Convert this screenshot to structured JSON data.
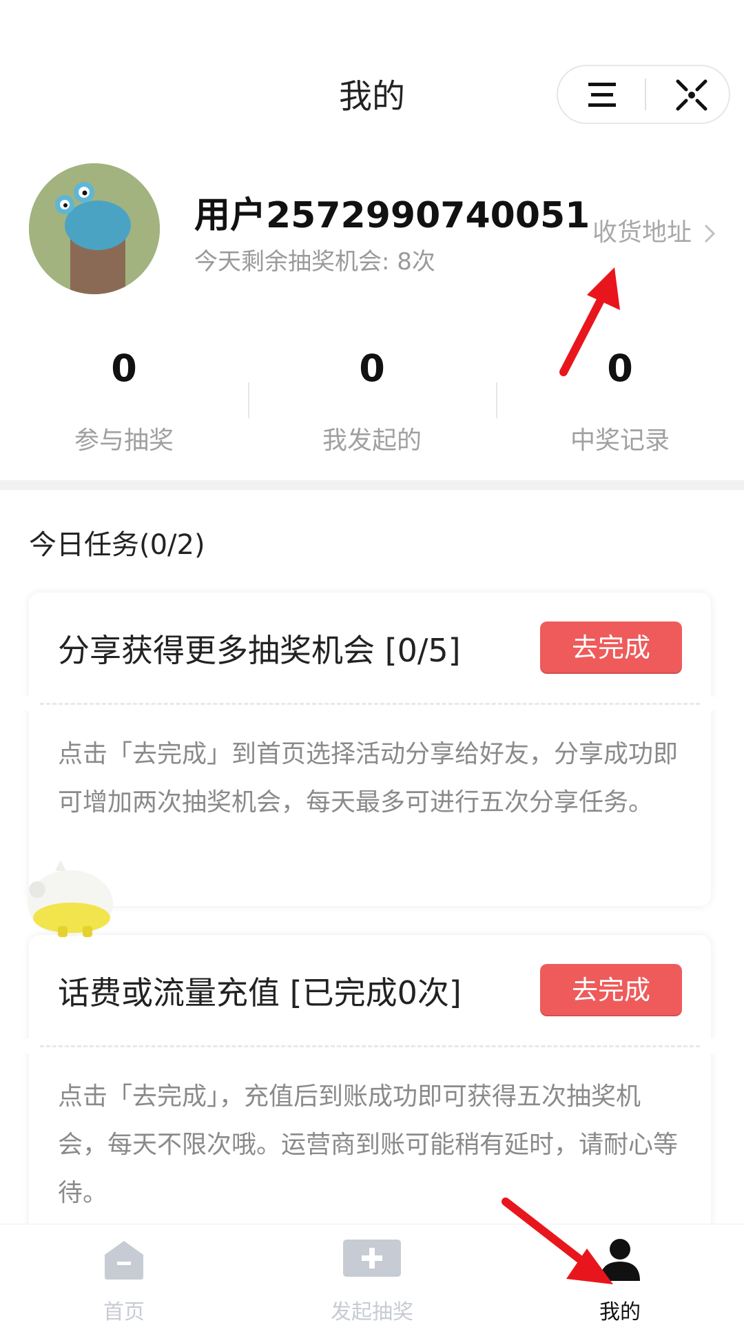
{
  "header": {
    "title": "我的"
  },
  "profile": {
    "username": "用户2572990740051",
    "chances": "今天剩余抽奖机会: 8次",
    "address_link": "收货地址"
  },
  "stats": [
    {
      "value": "0",
      "label": "参与抽奖"
    },
    {
      "value": "0",
      "label": "我发起的"
    },
    {
      "value": "0",
      "label": "中奖记录"
    }
  ],
  "tasks": {
    "title": "今日任务(0/2)",
    "items": [
      {
        "title": "分享获得更多抽奖机会 [0/5]",
        "button": "去完成",
        "description": "点击「去完成」到首页选择活动分享给好友，分享成功即可增加两次抽奖机会，每天最多可进行五次分享任务。"
      },
      {
        "title": "话费或流量充值 [已完成0次]",
        "button": "去完成",
        "description": "点击「去完成」，充值后到账成功即可获得五次抽奖机会，每天不限次哦。运营商到账可能稍有延时，请耐心等待。"
      }
    ]
  },
  "tabbar": {
    "items": [
      {
        "label": "首页",
        "icon": "home-icon"
      },
      {
        "label": "发起抽奖",
        "icon": "plus-icon"
      },
      {
        "label": "我的",
        "icon": "user-icon"
      }
    ],
    "active_index": 2
  },
  "colors": {
    "accent": "#ef5b5b",
    "annotation_arrow": "#e8161c",
    "muted_text": "#a0a0a0",
    "tab_inactive": "#c7cbd3"
  }
}
